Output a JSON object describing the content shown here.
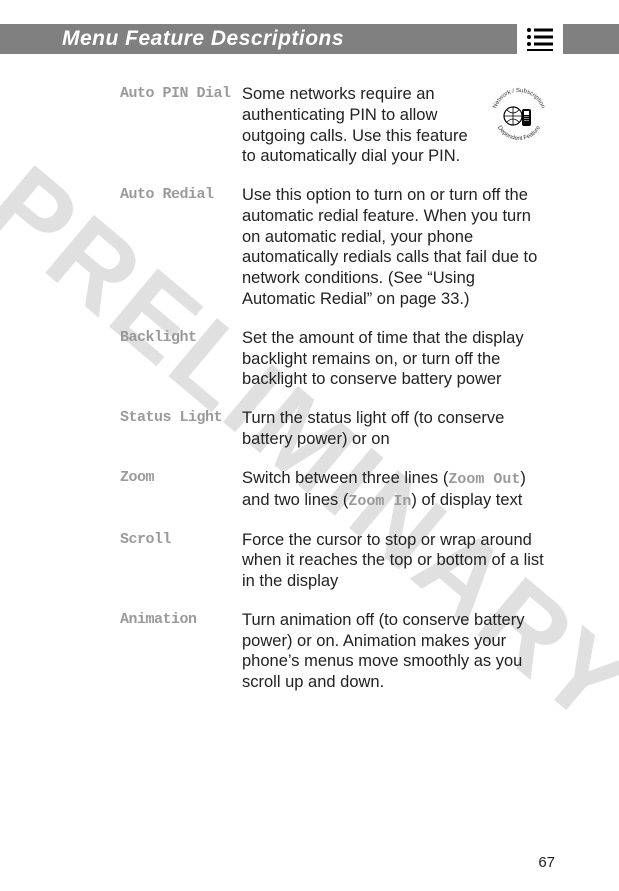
{
  "watermark": "PRELIMINARY",
  "header": {
    "title": "Menu Feature Descriptions"
  },
  "badge": {
    "top": "Network / Subscription",
    "bottom": "Dependent Feature"
  },
  "rows": [
    {
      "term": "Auto PIN Dial",
      "desc": "Some networks require an authenticating PIN to allow outgoing calls. Use this feature to automatically dial your PIN."
    },
    {
      "term": "Auto Redial",
      "desc": "Use this option to turn on or turn off the automatic redial feature. When you turn on automatic redial, your phone automatically redials calls that fail due to network conditions. (See “Using Automatic Redial” on page 33.)"
    },
    {
      "term": "Backlight",
      "desc": "Set the amount of time that the display backlight remains on, or turn off the backlight to conserve battery power"
    },
    {
      "term": "Status Light",
      "desc": "Turn the status light off (to conserve battery power) or on"
    },
    {
      "term": "Zoom",
      "desc_parts": [
        "Switch between three lines (",
        "Zoom Out",
        ") and two lines (",
        "Zoom In",
        ") of display text"
      ]
    },
    {
      "term": "Scroll",
      "desc": "Force the cursor to stop or wrap around when it reaches the top or bottom of a list in the display"
    },
    {
      "term": "Animation",
      "desc": "Turn animation off (to conserve battery power) or on. Animation makes your phone’s menus move smoothly as you scroll up and down."
    }
  ],
  "page_number": "67"
}
